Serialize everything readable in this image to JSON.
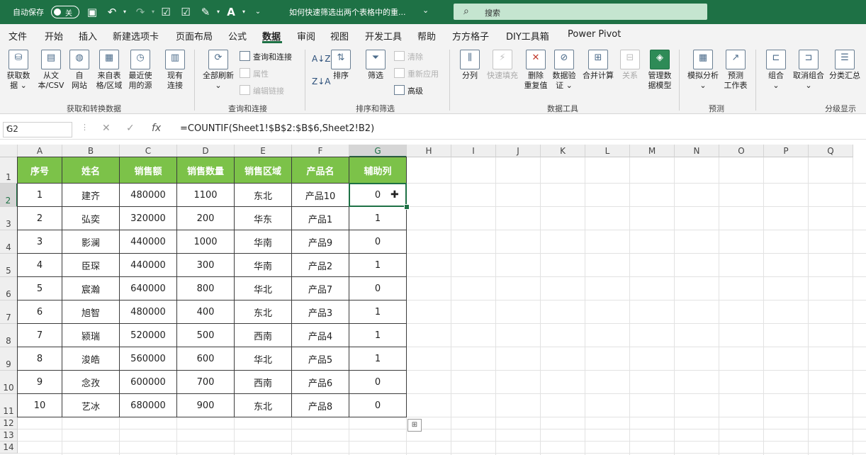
{
  "titlebar": {
    "autosave_label": "自动保存",
    "autosave_state": "关",
    "doc_title": "如何快速筛选出两个表格中的重...",
    "search_placeholder": "搜索",
    "accent": "#1e7145"
  },
  "tabs": [
    "文件",
    "开始",
    "插入",
    "新建选项卡",
    "页面布局",
    "公式",
    "数据",
    "审阅",
    "视图",
    "开发工具",
    "帮助",
    "方方格子",
    "DIY工具箱",
    "Power Pivot"
  ],
  "active_tab": "数据",
  "ribbon": {
    "get_transform": {
      "label": "获取和转换数据",
      "buttons": [
        {
          "l1": "获取数",
          "l2": "据 ⌄",
          "icon": "database-icon"
        },
        {
          "l1": "从文",
          "l2": "本/CSV",
          "icon": "text-file-icon"
        },
        {
          "l1": "自",
          "l2": "网站",
          "icon": "web-icon"
        },
        {
          "l1": "来自表",
          "l2": "格/区域",
          "icon": "table-icon"
        },
        {
          "l1": "最近使",
          "l2": "用的源",
          "icon": "recent-source-icon"
        },
        {
          "l1": "现有",
          "l2": "连接",
          "icon": "existing-connection-icon"
        }
      ]
    },
    "queries": {
      "label": "查询和连接",
      "refresh_l1": "全部刷新",
      "refresh_l2": "⌄",
      "items": [
        {
          "text": "查询和连接",
          "disabled": false
        },
        {
          "text": "属性",
          "disabled": true
        },
        {
          "text": "编辑链接",
          "disabled": true
        }
      ]
    },
    "sort_filter": {
      "label": "排序和筛选",
      "sort": "排序",
      "filter": "筛选",
      "az": "A↓Z",
      "za": "Z↓A",
      "items": [
        {
          "text": "清除",
          "disabled": true
        },
        {
          "text": "重新应用",
          "disabled": true
        },
        {
          "text": "高级",
          "disabled": false
        }
      ]
    },
    "data_tools": {
      "label": "数据工具",
      "buttons": [
        {
          "l1": "分列",
          "l2": "",
          "disabled": false
        },
        {
          "l1": "快速填充",
          "l2": "",
          "disabled": true
        },
        {
          "l1": "删除",
          "l2": "重复值",
          "disabled": false
        },
        {
          "l1": "数据验",
          "l2": "证 ⌄",
          "disabled": false
        },
        {
          "l1": "合并计算",
          "l2": "",
          "disabled": false
        },
        {
          "l1": "关系",
          "l2": "",
          "disabled": true
        },
        {
          "l1": "管理数",
          "l2": "据模型",
          "disabled": false
        }
      ]
    },
    "forecast": {
      "label": "预测",
      "buttons": [
        {
          "l1": "模拟分析",
          "l2": "⌄"
        },
        {
          "l1": "预测",
          "l2": "工作表"
        }
      ]
    },
    "outline": {
      "label": "分级显示",
      "buttons": [
        {
          "l1": "组合",
          "l2": "⌄"
        },
        {
          "l1": "取消组合",
          "l2": "⌄"
        },
        {
          "l1": "分类汇总",
          "l2": ""
        }
      ]
    }
  },
  "formula_bar": {
    "name_box": "G2",
    "fx": "fx",
    "formula": "=COUNTIF(Sheet1!$B$2:$B$6,Sheet2!B2)"
  },
  "sheet": {
    "columns": [
      "A",
      "B",
      "C",
      "D",
      "E",
      "F",
      "G",
      "H",
      "I",
      "J",
      "K",
      "L",
      "M",
      "N",
      "O",
      "P",
      "Q"
    ],
    "rows": [
      "1",
      "2",
      "3",
      "4",
      "5",
      "6",
      "7",
      "8",
      "9",
      "10",
      "11",
      "12",
      "13",
      "14"
    ],
    "selected_cell": "G2",
    "header_color": "#7cc249",
    "table_headers": [
      "序号",
      "姓名",
      "销售额",
      "销售数量",
      "销售区域",
      "产品名",
      "辅助列"
    ],
    "table_rows": [
      [
        "1",
        "建齐",
        "480000",
        "1100",
        "东北",
        "产品10",
        "0"
      ],
      [
        "2",
        "弘奕",
        "320000",
        "200",
        "华东",
        "产品1",
        "1"
      ],
      [
        "3",
        "影澜",
        "440000",
        "1000",
        "华南",
        "产品9",
        "0"
      ],
      [
        "4",
        "臣琛",
        "440000",
        "300",
        "华南",
        "产品2",
        "1"
      ],
      [
        "5",
        "宸瀚",
        "640000",
        "800",
        "华北",
        "产品7",
        "0"
      ],
      [
        "6",
        "旭智",
        "480000",
        "400",
        "东北",
        "产品3",
        "1"
      ],
      [
        "7",
        "颍瑞",
        "520000",
        "500",
        "西南",
        "产品4",
        "1"
      ],
      [
        "8",
        "浚皓",
        "560000",
        "600",
        "华北",
        "产品5",
        "1"
      ],
      [
        "9",
        "念孜",
        "600000",
        "700",
        "西南",
        "产品6",
        "0"
      ],
      [
        "10",
        "艺冰",
        "680000",
        "900",
        "东北",
        "产品8",
        "0"
      ]
    ]
  }
}
